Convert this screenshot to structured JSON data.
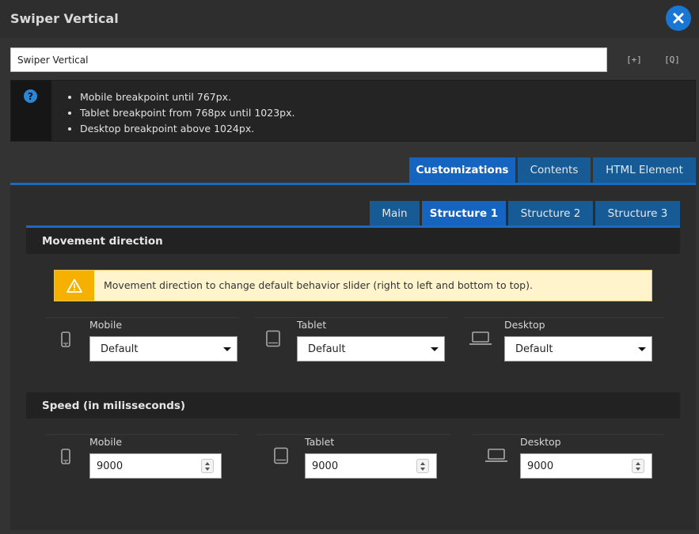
{
  "window": {
    "title": "Swiper Vertical",
    "close_icon": "close-icon"
  },
  "name_field": {
    "value": "Swiper Vertical",
    "buttons": [
      {
        "label": "[+]",
        "icon": "expand-icon"
      },
      {
        "label": "[Q]",
        "icon": "preview-icon"
      }
    ]
  },
  "help": {
    "icon": "question-icon",
    "items": [
      "Mobile breakpoint until 767px.",
      "Tablet breakpoint from 768px until 1023px.",
      "Desktop breakpoint above 1024px."
    ]
  },
  "main_tabs": [
    {
      "label": "Customizations",
      "active": true
    },
    {
      "label": "Contents",
      "active": false
    },
    {
      "label": "HTML Element",
      "active": false
    }
  ],
  "sub_tabs": [
    {
      "label": "Main",
      "active": false
    },
    {
      "label": "Structure 1",
      "active": true
    },
    {
      "label": "Structure 2",
      "active": false
    },
    {
      "label": "Structure 3",
      "active": false
    }
  ],
  "movement": {
    "heading": "Movement direction",
    "alert_icon": "warning-icon",
    "alert_text": "Movement direction to change default behavior slider (right to left and bottom to top).",
    "fields": [
      {
        "device": "Mobile",
        "icon": "mobile-icon",
        "value": "Default"
      },
      {
        "device": "Tablet",
        "icon": "tablet-icon",
        "value": "Default"
      },
      {
        "device": "Desktop",
        "icon": "laptop-icon",
        "value": "Default"
      }
    ]
  },
  "speed": {
    "heading": "Speed (in milisseconds)",
    "fields": [
      {
        "device": "Mobile",
        "icon": "mobile-icon",
        "value": "9000"
      },
      {
        "device": "Tablet",
        "icon": "tablet-icon",
        "value": "9000"
      },
      {
        "device": "Desktop",
        "icon": "laptop-icon",
        "value": "9000"
      }
    ]
  },
  "colors": {
    "accent": "#1565c0",
    "tab_inactive": "#165a96",
    "warning": "#f6b100",
    "warning_bg": "#fff4cc"
  }
}
